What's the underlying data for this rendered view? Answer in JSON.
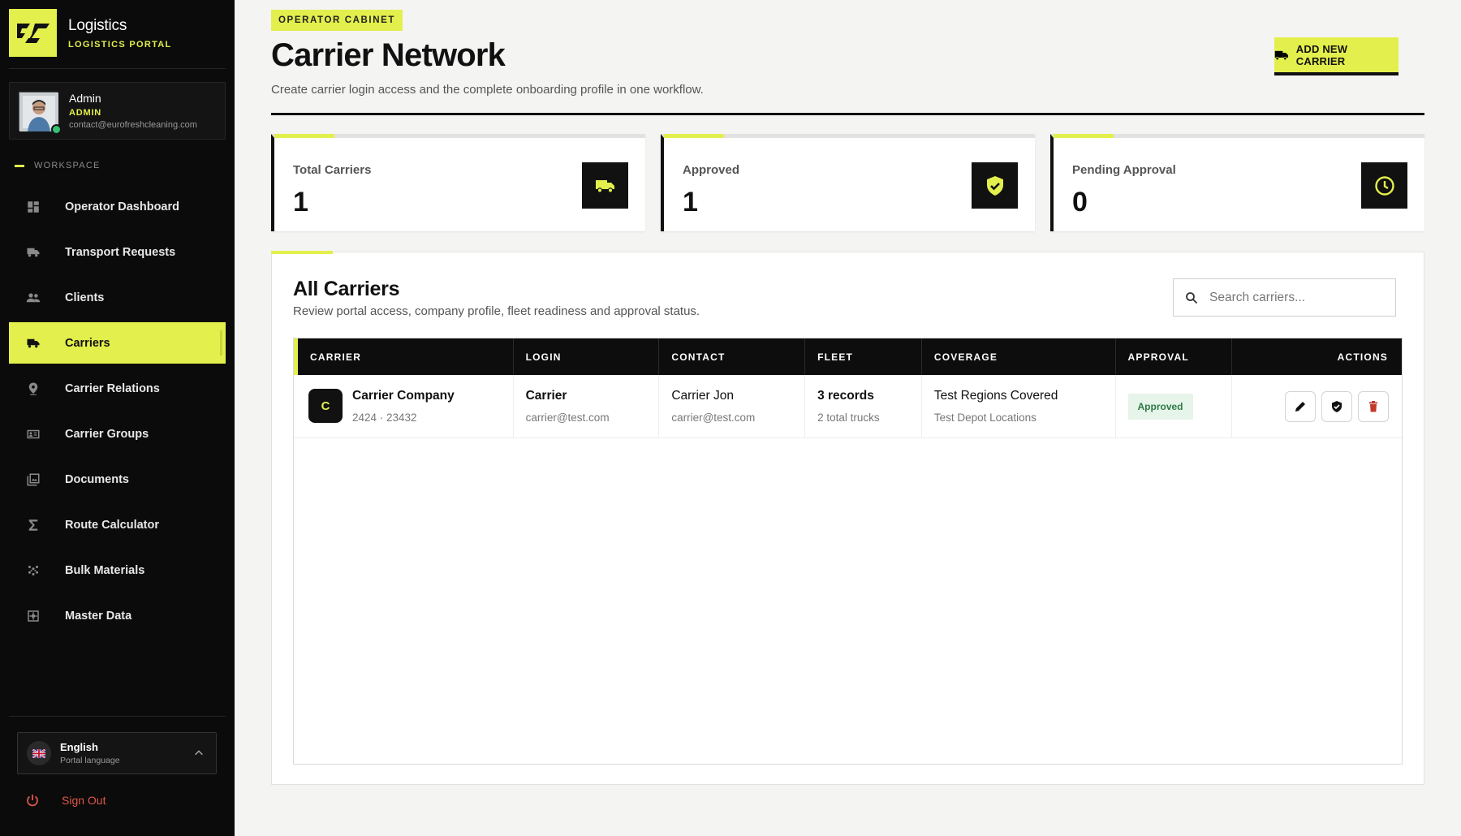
{
  "brand": {
    "title": "Logistics",
    "subtitle": "LOGISTICS PORTAL"
  },
  "user": {
    "name": "Admin",
    "role": "ADMIN",
    "email": "contact@eurofreshcleaning.com"
  },
  "sidebar": {
    "section_label": "WORKSPACE",
    "items": [
      {
        "label": "Operator Dashboard",
        "icon": "dashboard-icon"
      },
      {
        "label": "Transport Requests",
        "icon": "truck-icon"
      },
      {
        "label": "Clients",
        "icon": "people-icon"
      },
      {
        "label": "Carriers",
        "icon": "truck-icon",
        "active": true
      },
      {
        "label": "Carrier Relations",
        "icon": "location-pin-icon"
      },
      {
        "label": "Carrier Groups",
        "icon": "id-card-icon"
      },
      {
        "label": "Documents",
        "icon": "image-stack-icon"
      },
      {
        "label": "Route Calculator",
        "icon": "sigma-icon"
      },
      {
        "label": "Bulk Materials",
        "icon": "grain-icon"
      },
      {
        "label": "Master Data",
        "icon": "data-settings-icon"
      }
    ]
  },
  "language": {
    "name": "English",
    "subtitle": "Portal language"
  },
  "sign_out": "Sign Out",
  "header": {
    "eyebrow": "OPERATOR CABINET",
    "title": "Carrier Network",
    "description": "Create carrier login access and the complete onboarding profile in one workflow.",
    "add_button": "ADD NEW CARRIER"
  },
  "stats": [
    {
      "label": "Total Carriers",
      "value": "1",
      "icon": "truck-icon"
    },
    {
      "label": "Approved",
      "value": "1",
      "icon": "shield-check-icon"
    },
    {
      "label": "Pending Approval",
      "value": "0",
      "icon": "clock-icon"
    }
  ],
  "panel": {
    "title": "All Carriers",
    "description": "Review portal access, company profile, fleet readiness and approval status.",
    "search_placeholder": "Search carriers..."
  },
  "table": {
    "columns": [
      "CARRIER",
      "LOGIN",
      "CONTACT",
      "FLEET",
      "COVERAGE",
      "APPROVAL",
      "ACTIONS"
    ],
    "rows": [
      {
        "initial": "C",
        "carrier_name": "Carrier Company",
        "carrier_sub": "2424 · 23432",
        "login_name": "Carrier",
        "login_email": "carrier@test.com",
        "contact_name": "Carrier Jon",
        "contact_email": "carrier@test.com",
        "fleet_records": "3 records",
        "fleet_trucks": "2 total trucks",
        "coverage_regions": "Test Regions Covered",
        "coverage_depots": "Test Depot Locations",
        "approval": "Approved"
      }
    ]
  },
  "colors": {
    "accent": "#e3ef4c",
    "sidebar_bg": "#0b0b0b",
    "danger": "#c0392b",
    "approved_bg": "#e6f4ea",
    "approved_text": "#2f7a45"
  }
}
